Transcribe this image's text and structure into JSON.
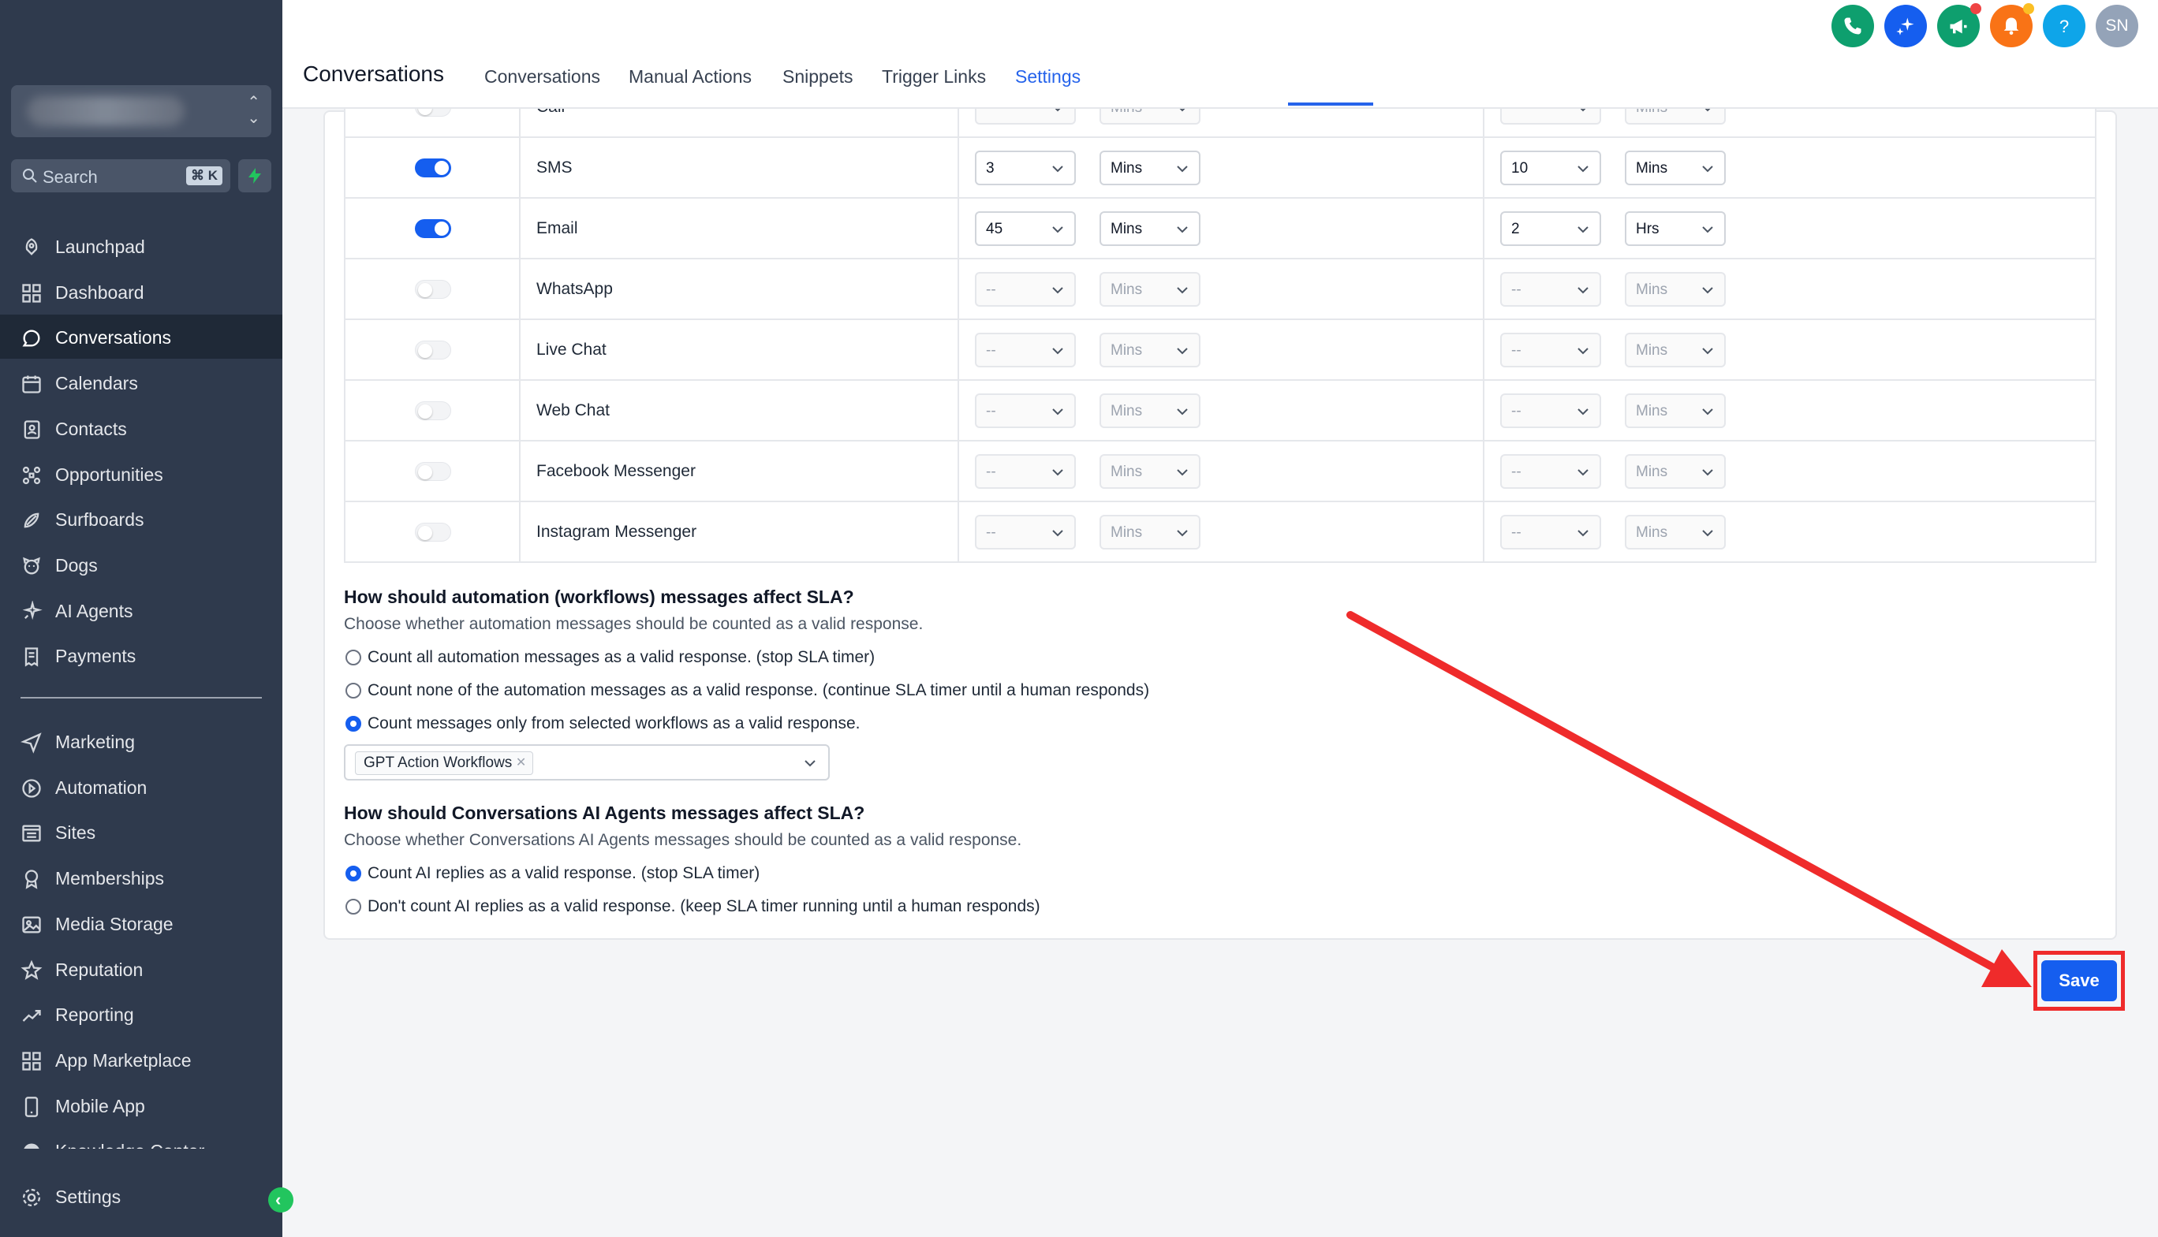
{
  "sidebar": {
    "search": {
      "label": "Search",
      "shortcut": "⌘ K"
    },
    "items": [
      {
        "label": "Launchpad",
        "icon": "rocket-icon"
      },
      {
        "label": "Dashboard",
        "icon": "grid-icon"
      },
      {
        "label": "Conversations",
        "icon": "chat-icon",
        "active": true
      },
      {
        "label": "Calendars",
        "icon": "calendar-icon"
      },
      {
        "label": "Contacts",
        "icon": "contacts-icon"
      },
      {
        "label": "Opportunities",
        "icon": "opportunities-icon"
      },
      {
        "label": "Surfboards",
        "icon": "surfboard-icon"
      },
      {
        "label": "Dogs",
        "icon": "dog-icon"
      },
      {
        "label": "AI Agents",
        "icon": "sparkle-icon"
      },
      {
        "label": "Payments",
        "icon": "receipt-icon"
      }
    ],
    "items2": [
      {
        "label": "Marketing",
        "icon": "send-icon"
      },
      {
        "label": "Automation",
        "icon": "automation-icon"
      },
      {
        "label": "Sites",
        "icon": "sites-icon"
      },
      {
        "label": "Memberships",
        "icon": "award-icon"
      },
      {
        "label": "Media Storage",
        "icon": "image-icon"
      },
      {
        "label": "Reputation",
        "icon": "star-icon"
      },
      {
        "label": "Reporting",
        "icon": "trend-icon"
      },
      {
        "label": "App Marketplace",
        "icon": "apps-icon"
      },
      {
        "label": "Mobile App",
        "icon": "phone-icon"
      },
      {
        "label": "Knowledge Center",
        "icon": "book-icon"
      }
    ],
    "settings": {
      "label": "Settings",
      "icon": "gear-icon"
    }
  },
  "header": {
    "title": "Conversations",
    "tabs": [
      "Conversations",
      "Manual Actions",
      "Snippets",
      "Trigger Links",
      "Settings"
    ],
    "active_tab": "Settings",
    "avatar_initials": "SN",
    "colors": {
      "phone": "#0e9f6e",
      "ai": "#155eef",
      "announce": "#0e9f6e",
      "bell": "#f97316",
      "help": "#0ea5e9",
      "avatar": "#94a3b8"
    }
  },
  "sla_table": {
    "rows": [
      {
        "channel": "Call",
        "enabled": false,
        "first_value": "--",
        "first_unit": "Mins",
        "second_value": "--",
        "second_unit": "Mins"
      },
      {
        "channel": "SMS",
        "enabled": true,
        "first_value": "3",
        "first_unit": "Mins",
        "second_value": "10",
        "second_unit": "Mins"
      },
      {
        "channel": "Email",
        "enabled": true,
        "first_value": "45",
        "first_unit": "Mins",
        "second_value": "2",
        "second_unit": "Hrs"
      },
      {
        "channel": "WhatsApp",
        "enabled": false,
        "first_value": "--",
        "first_unit": "Mins",
        "second_value": "--",
        "second_unit": "Mins"
      },
      {
        "channel": "Live Chat",
        "enabled": false,
        "first_value": "--",
        "first_unit": "Mins",
        "second_value": "--",
        "second_unit": "Mins"
      },
      {
        "channel": "Web Chat",
        "enabled": false,
        "first_value": "--",
        "first_unit": "Mins",
        "second_value": "--",
        "second_unit": "Mins"
      },
      {
        "channel": "Facebook Messenger",
        "enabled": false,
        "first_value": "--",
        "first_unit": "Mins",
        "second_value": "--",
        "second_unit": "Mins"
      },
      {
        "channel": "Instagram Messenger",
        "enabled": false,
        "first_value": "--",
        "first_unit": "Mins",
        "second_value": "--",
        "second_unit": "Mins"
      }
    ]
  },
  "automation_sla": {
    "title": "How should automation (workflows) messages affect SLA?",
    "description": "Choose whether automation messages should be counted as a valid response.",
    "options": [
      "Count all automation messages as a valid response. (stop SLA timer)",
      "Count none of the automation messages as a valid response. (continue SLA timer until a human responds)",
      "Count messages only from selected workflows as a valid response."
    ],
    "selected_index": 2,
    "selected_workflows": [
      "GPT Action Workflows"
    ]
  },
  "ai_sla": {
    "title": "How should Conversations AI Agents messages affect SLA?",
    "description": "Choose whether Conversations AI Agents messages should be counted as a valid response.",
    "options": [
      "Count AI replies as a valid response. (stop SLA timer)",
      "Don't count AI replies as a valid response. (keep SLA timer running until a human responds)"
    ],
    "selected_index": 0
  },
  "save_label": "Save"
}
